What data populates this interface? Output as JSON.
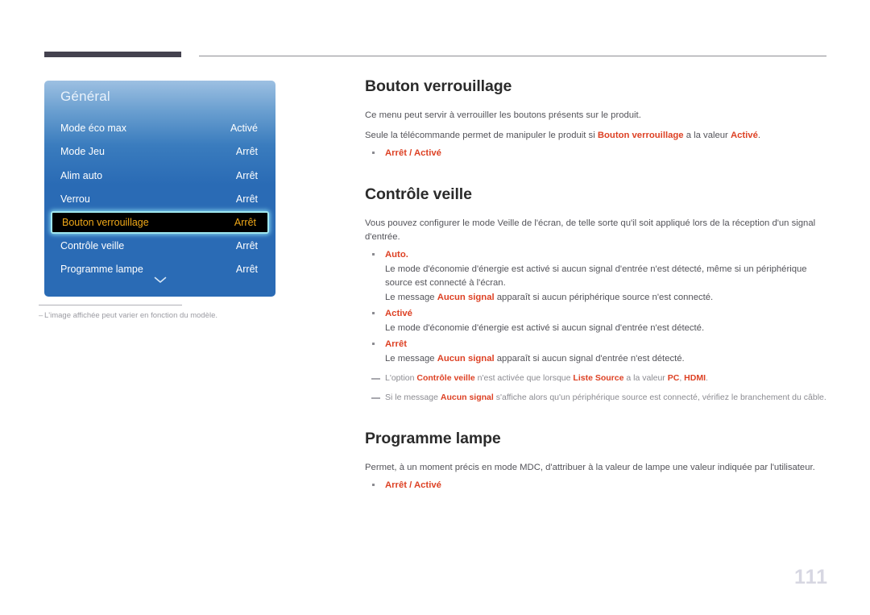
{
  "page": {
    "number": "111"
  },
  "osd": {
    "title": "Général",
    "rows": [
      {
        "label": "Mode éco max",
        "value": "Activé",
        "selected": false
      },
      {
        "label": "Mode Jeu",
        "value": "Arrêt",
        "selected": false
      },
      {
        "label": "Alim auto",
        "value": "Arrêt",
        "selected": false
      },
      {
        "label": "Verrou",
        "value": "Arrêt",
        "selected": false
      },
      {
        "label": "Bouton verrouillage",
        "value": "Arrêt",
        "selected": true
      },
      {
        "label": "Contrôle veille",
        "value": "Arrêt",
        "selected": false
      },
      {
        "label": "Programme lampe",
        "value": "Arrêt",
        "selected": false
      }
    ],
    "more_icon": "chevron-down-icon",
    "footnote_dash": "–",
    "footnote": "L'image affichée peut varier en fonction du modèle."
  },
  "sections": {
    "bouton_verrouillage": {
      "title": "Bouton verrouillage",
      "intro": "Ce menu peut servir à verrouiller les boutons présents sur le produit.",
      "line2_a": "Seule la télécommande permet de manipuler le produit si ",
      "line2_b": "Bouton verrouillage",
      "line2_c": " a la valeur ",
      "line2_d": "Activé",
      "line2_e": ".",
      "option": "Arrêt / Activé"
    },
    "controle_veille": {
      "title": "Contrôle veille",
      "intro": "Vous pouvez configurer le mode Veille de l'écran, de telle sorte qu'il soit appliqué lors de la réception d'un signal d'entrée.",
      "items": [
        {
          "head": "Auto.",
          "sub1": "Le mode d'économie d'énergie est activé si aucun signal d'entrée n'est détecté, même si un périphérique source est connecté à l'écran.",
          "sub2_a": "Le message ",
          "sub2_b": "Aucun signal",
          "sub2_c": " apparaît si aucun périphérique source n'est connecté."
        },
        {
          "head": "Activé",
          "sub1": "Le mode d'économie d'énergie est activé si aucun signal d'entrée n'est détecté."
        },
        {
          "head": "Arrêt",
          "sub2_a": "Le message ",
          "sub2_b": "Aucun signal",
          "sub2_c": " apparaît si aucun signal d'entrée n'est détecté."
        }
      ],
      "note1_a": "L'option ",
      "note1_b": "Contrôle veille",
      "note1_c": " n'est activée que lorsque ",
      "note1_d": "Liste Source",
      "note1_e": " a la valeur ",
      "note1_f": "PC",
      "note1_g": ", ",
      "note1_h": "HDMI",
      "note1_i": ".",
      "note2_a": "Si le message ",
      "note2_b": "Aucun signal",
      "note2_c": " s'affiche alors qu'un périphérique source est connecté, vérifiez le branchement du câble."
    },
    "programme_lampe": {
      "title": "Programme lampe",
      "intro": "Permet, à un moment précis en mode MDC, d'attribuer à la valeur de lampe une valeur indiquée par l'utilisateur.",
      "option": "Arrêt / Activé"
    }
  },
  "colors": {
    "accent_red": "#dd4124",
    "osd_blue_top": "#9dc0e2",
    "osd_blue_bottom": "#2a6bb5",
    "osd_highlight_text": "#f0a818",
    "osd_highlight_border": "#9fe7ef",
    "page_number": "#d7d7e2",
    "rule_dark": "#44424f"
  }
}
